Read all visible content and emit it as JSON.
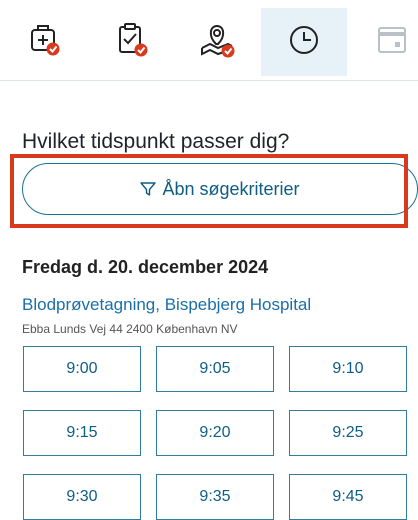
{
  "steps": [
    {
      "icon": "medical-bag-icon",
      "status": "done"
    },
    {
      "icon": "clipboard-check-icon",
      "status": "done"
    },
    {
      "icon": "location-pin-icon",
      "status": "done"
    },
    {
      "icon": "clock-icon",
      "status": "active"
    },
    {
      "icon": "calendar-icon",
      "status": "pending"
    }
  ],
  "question": "Hvilket tidspunkt passer dig?",
  "filter_button": {
    "label": "Åbn søgekriterier",
    "icon": "filter-icon"
  },
  "date_heading": "Fredag d. 20. december 2024",
  "location": {
    "name": "Blodprøvetagning, Bispebjerg Hospital",
    "address": "Ebba Lunds Vej 44 2400 København NV"
  },
  "slots": [
    "9:00",
    "9:05",
    "9:10",
    "9:15",
    "9:20",
    "9:25",
    "9:30",
    "9:35",
    "9:45"
  ],
  "colors": {
    "accent": "#0e5d84",
    "link": "#1b6fa8",
    "done_badge": "#d9391c",
    "highlight": "#d9391c",
    "active_step_bg": "#e6f1f8"
  }
}
